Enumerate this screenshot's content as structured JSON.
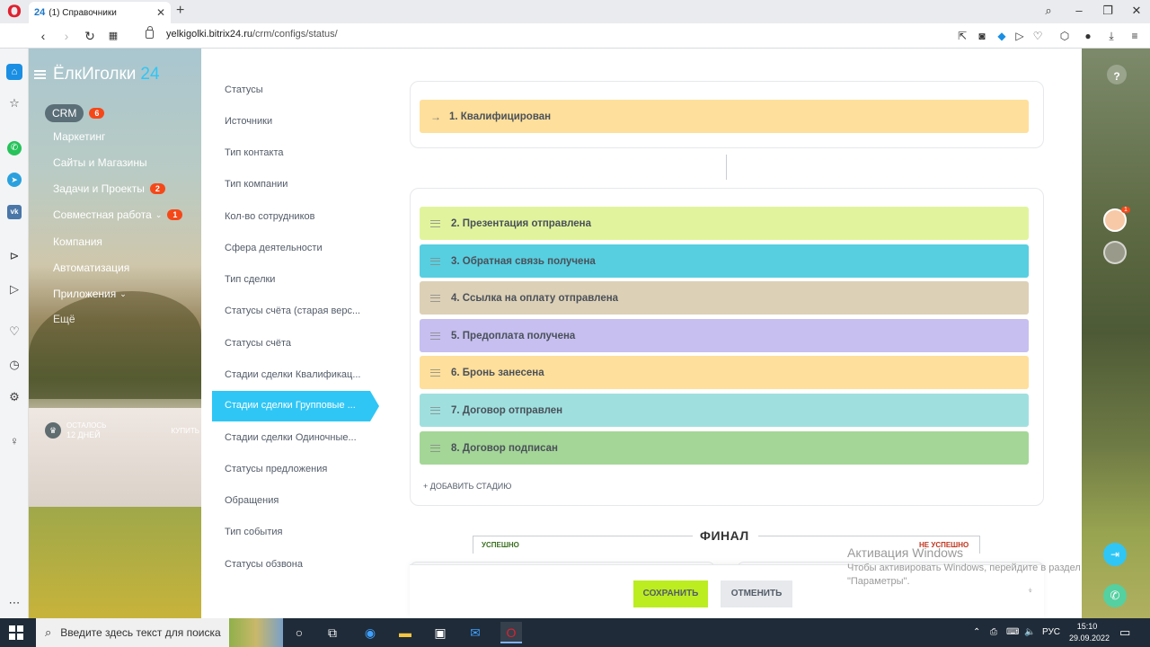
{
  "browser": {
    "tab_favicon": "24",
    "tab_title": "(1) Справочники",
    "new_tab": "+",
    "url_domain": "yelkigolki.bitrix24.ru",
    "url_path": "/crm/configs/status/"
  },
  "portal": {
    "logo_name": "ЁлкИголки",
    "logo_num": "24"
  },
  "left_menu": {
    "items": [
      {
        "label": "CRM",
        "badge": "6"
      },
      {
        "label": "Маркетинг"
      },
      {
        "label": "Сайты и Магазины"
      },
      {
        "label": "Задачи и Проекты",
        "badge": "2"
      },
      {
        "label": "Совместная работа",
        "badge": "1"
      },
      {
        "label": "Компания"
      },
      {
        "label": "Автоматизация"
      },
      {
        "label": "Приложения"
      },
      {
        "label": "Ещё"
      }
    ],
    "trial_line1": "ОСТАЛОСЬ",
    "trial_line2": "12 ДНЕЙ",
    "trial_buy": "КУПИТЬ"
  },
  "reference_list": {
    "items": [
      "Статусы",
      "Источники",
      "Тип контакта",
      "Тип компании",
      "Кол-во сотрудников",
      "Сфера деятельности",
      "Тип сделки",
      "Статусы счёта (старая верс...",
      "Статусы счёта",
      "Стадии сделки Квалификац...",
      "Стадии сделки Групповые ...",
      "Стадии сделки Одиночные...",
      "Статусы предложения",
      "Обращения",
      "Тип события",
      "Статусы обзвона"
    ],
    "active_index": 10
  },
  "stages": {
    "first": {
      "label": "1. Квалифицирован",
      "color": "#fedf9b"
    },
    "items": [
      {
        "label": "2. Презентация отправлена",
        "color": "#e1f49d"
      },
      {
        "label": "3. Обратная связь получена",
        "color": "#57cfe0"
      },
      {
        "label": "4. Ссылка на оплату отправлена",
        "color": "#dcd0b6"
      },
      {
        "label": "5. Предоплата получена",
        "color": "#c6bff0"
      },
      {
        "label": "6. Бронь занесена",
        "color": "#fedf9b"
      },
      {
        "label": "7. Договор отправлен",
        "color": "#9fe0df"
      },
      {
        "label": "8. Договор подписан",
        "color": "#a4d697"
      }
    ],
    "add_stage": "+ ДОБАВИТЬ СТАДИЮ"
  },
  "final": {
    "title": "ФИНАЛ",
    "success": "УСПЕШНО",
    "fail": "НЕ УСПЕШНО",
    "success_color": "#3a6e1f",
    "fail_color": "#c0351e"
  },
  "footer": {
    "save": "СОХРАНИТЬ",
    "cancel": "ОТМЕНИТЬ"
  },
  "watermark": {
    "line1": "Активация Windows",
    "line2": "Чтобы активировать Windows, перейдите в раздел",
    "line3": "\"Параметры\"."
  },
  "right_panel": {
    "help": "?",
    "avatar_badge": "1"
  },
  "taskbar": {
    "search_placeholder": "Введите здесь текст для поиска",
    "lang": "РУС",
    "time": "15:10",
    "date": "29.09.2022"
  }
}
